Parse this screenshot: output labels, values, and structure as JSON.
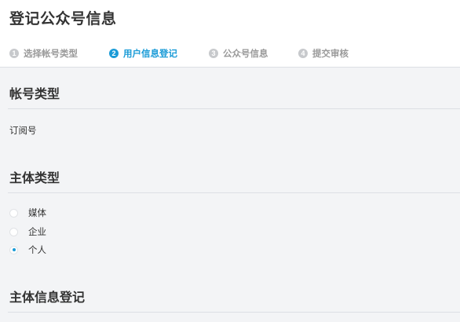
{
  "page_title": "登记公众号信息",
  "steps": [
    {
      "num": "1",
      "label": "选择帐号类型",
      "active": false
    },
    {
      "num": "2",
      "label": "用户信息登记",
      "active": true
    },
    {
      "num": "3",
      "label": "公众号信息",
      "active": false
    },
    {
      "num": "4",
      "label": "提交审核",
      "active": false
    }
  ],
  "account_type": {
    "title": "帐号类型",
    "value": "订阅号"
  },
  "subject_type": {
    "title": "主体类型",
    "options": [
      {
        "label": "媒体",
        "checked": false
      },
      {
        "label": "企业",
        "checked": false
      },
      {
        "label": "个人",
        "checked": true
      }
    ]
  },
  "subject_info": {
    "title": "主体信息登记"
  },
  "colors": {
    "accent": "#1a9bd7",
    "inactive_step": "#9a9a9a",
    "background": "#f3f4f6"
  }
}
